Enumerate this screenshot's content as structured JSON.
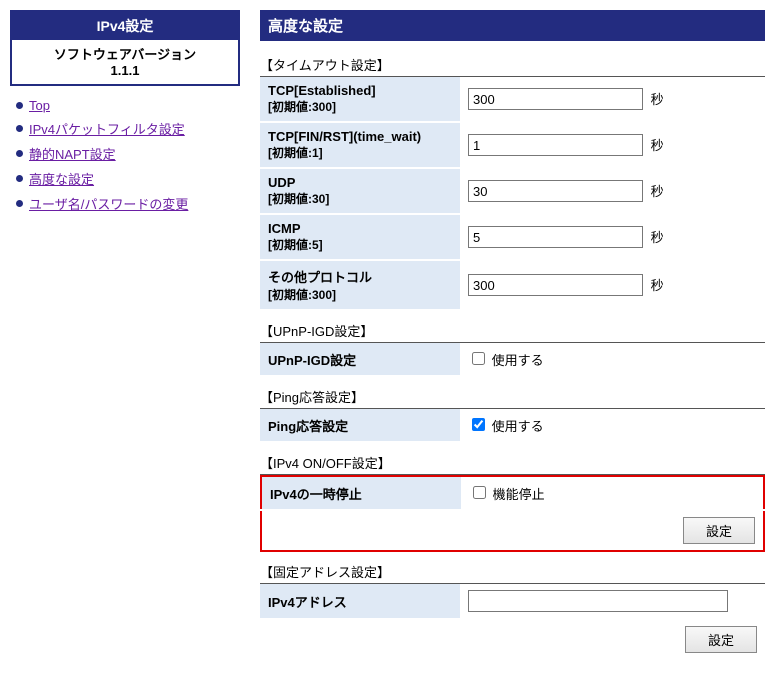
{
  "sidebar": {
    "box": {
      "title": "IPv4設定",
      "sw_label": "ソフトウェアバージョン",
      "sw_version": "1.1.1"
    },
    "nav": {
      "top": "Top",
      "packet_filter": "IPv4パケットフィルタ設定",
      "static_napt": "静的NAPT設定",
      "advanced": "高度な設定",
      "userpass": "ユーザ名/パスワードの変更"
    }
  },
  "page": {
    "title": "高度な設定"
  },
  "sections": {
    "timeout": "【タイムアウト設定】",
    "upnp": "【UPnP-IGD設定】",
    "ping": "【Ping応答設定】",
    "ipv4_onoff": "【IPv4 ON/OFF設定】",
    "fixed_addr": "【固定アドレス設定】"
  },
  "timeout": {
    "tcp_est": {
      "label": "TCP[Established]",
      "sub": "[初期値:300]",
      "value": "300",
      "unit": "秒"
    },
    "tcp_fin": {
      "label": "TCP[FIN/RST](time_wait)",
      "sub": "[初期値:1]",
      "value": "1",
      "unit": "秒"
    },
    "udp": {
      "label": "UDP",
      "sub": "[初期値:30]",
      "value": "30",
      "unit": "秒"
    },
    "icmp": {
      "label": "ICMP",
      "sub": "[初期値:5]",
      "value": "5",
      "unit": "秒"
    },
    "other": {
      "label": "その他プロトコル",
      "sub": "[初期値:300]",
      "value": "300",
      "unit": "秒"
    }
  },
  "upnp": {
    "row_label": "UPnP-IGD設定",
    "checkbox_label": "使用する",
    "checked": false
  },
  "ping": {
    "row_label": "Ping応答設定",
    "checkbox_label": "使用する",
    "checked": true
  },
  "ipv4_onoff": {
    "row_label": "IPv4の一時停止",
    "checkbox_label": "機能停止",
    "checked": false,
    "button": "設定"
  },
  "fixed_addr": {
    "row_label": "IPv4アドレス",
    "value": "",
    "button": "設定"
  }
}
